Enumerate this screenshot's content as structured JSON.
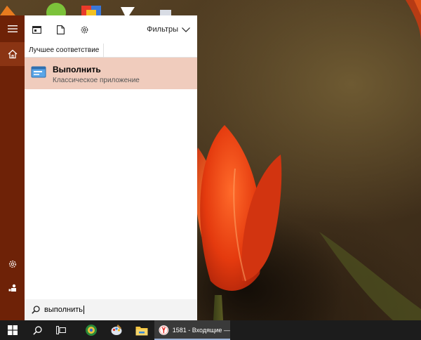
{
  "panel": {
    "filters_label": "Фильтры",
    "section_label": "Лучшее соответствие",
    "best_match": {
      "title": "Выполнить",
      "subtitle": "Классическое приложение",
      "icon": "run-dialog-icon"
    },
    "search": {
      "value": "выполнить",
      "icon": "search-icon"
    },
    "toolbar_icons": [
      "apps-icon",
      "documents-icon",
      "settings-icon"
    ]
  },
  "rail": {
    "items": [
      "hamburger-menu-icon",
      "home-icon",
      "settings-icon",
      "feedback-icon"
    ]
  },
  "taskbar": {
    "items": [
      "windows-start-icon",
      "search-icon",
      "task-view-icon",
      "system-app-icon",
      "paint-app-icon",
      "file-explorer-icon",
      "yandex-browser-icon"
    ],
    "browser_window_label": "1581 - Входящие —..."
  },
  "colors": {
    "accent": "#6e2207",
    "accent_light": "#8a3413",
    "selection": "#f0ccbd",
    "taskbar": "#1c1c1c"
  }
}
